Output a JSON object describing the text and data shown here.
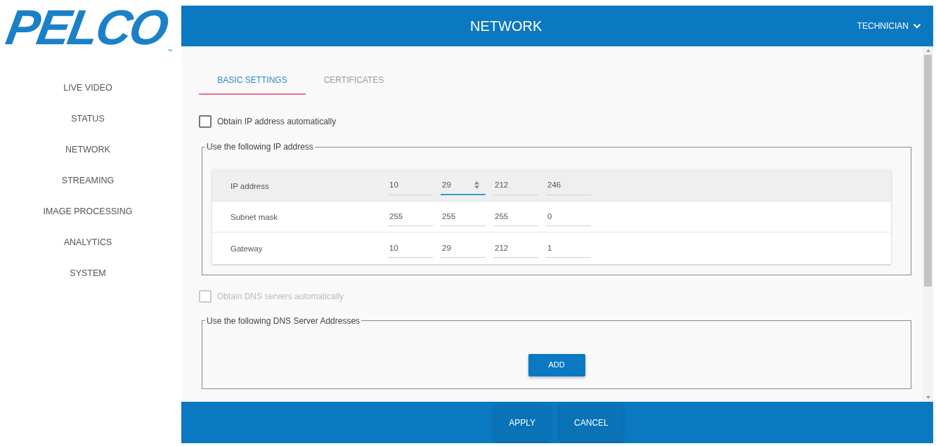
{
  "logo": {
    "text": "PELCO",
    "trademark": "™"
  },
  "sidebar": {
    "items": [
      {
        "label": "LIVE VIDEO"
      },
      {
        "label": "STATUS"
      },
      {
        "label": "NETWORK"
      },
      {
        "label": "STREAMING"
      },
      {
        "label": "IMAGE PROCESSING"
      },
      {
        "label": "ANALYTICS"
      },
      {
        "label": "SYSTEM"
      }
    ]
  },
  "header": {
    "title": "NETWORK",
    "user_menu": "TECHNICIAN"
  },
  "tabs": [
    {
      "label": "BASIC SETTINGS",
      "selected": true
    },
    {
      "label": "CERTIFICATES",
      "selected": false
    }
  ],
  "ip_auto": {
    "label": "Obtain IP address automatically",
    "checked": false,
    "disabled": false
  },
  "ip_group": {
    "legend": "Use the following IP address",
    "rows": [
      {
        "label": "IP address",
        "highlighted": true,
        "octets": [
          {
            "value": "10",
            "focused": false
          },
          {
            "value": "29",
            "focused": true
          },
          {
            "value": "212",
            "focused": false
          },
          {
            "value": "246",
            "focused": false
          }
        ]
      },
      {
        "label": "Subnet mask",
        "highlighted": false,
        "octets": [
          {
            "value": "255",
            "focused": false
          },
          {
            "value": "255",
            "focused": false
          },
          {
            "value": "255",
            "focused": false
          },
          {
            "value": "0",
            "focused": false
          }
        ]
      },
      {
        "label": "Gateway",
        "highlighted": false,
        "octets": [
          {
            "value": "10",
            "focused": false
          },
          {
            "value": "29",
            "focused": false
          },
          {
            "value": "212",
            "focused": false
          },
          {
            "value": "1",
            "focused": false
          }
        ]
      }
    ]
  },
  "dns_auto": {
    "label": "Obtain DNS servers automatically",
    "checked": false,
    "disabled": true
  },
  "dns_group": {
    "legend": "Use the following DNS Server Addresses",
    "add_button": "ADD"
  },
  "footer": {
    "buttons": [
      "APPLY",
      "CANCEL"
    ]
  }
}
